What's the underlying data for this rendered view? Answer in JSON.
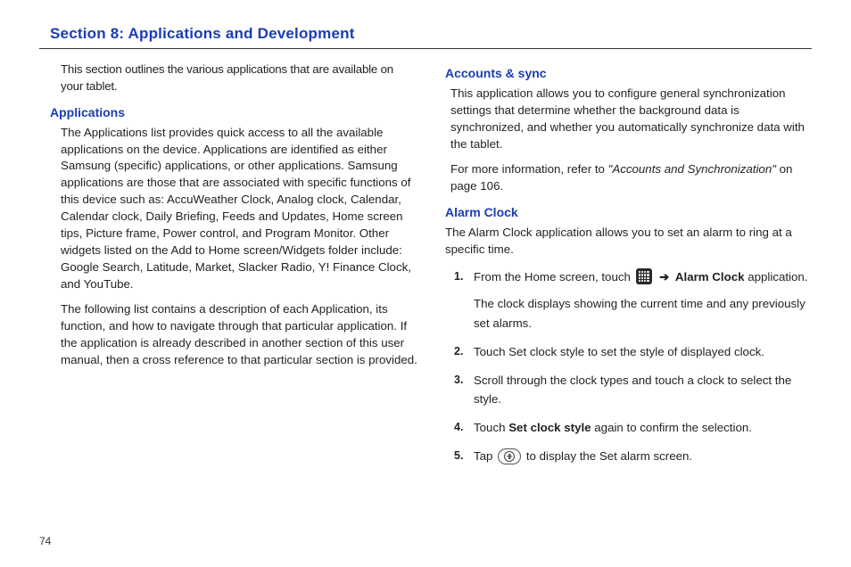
{
  "page": {
    "title": "Section 8: Applications and Development",
    "number": "74"
  },
  "left": {
    "intro": "This section outlines the various applications that are available on your tablet.",
    "applications": {
      "heading": "Applications",
      "p1": "The Applications list provides quick access to all the available applications on the device. Applications are identified as either Samsung (specific) applications, or other applications. Samsung applications are those that are associated with specific functions of this device such as: AccuWeather Clock, Analog clock, Calendar, Calendar clock, Daily Briefing, Feeds and Updates, Home screen tips, Picture frame, Power control, and Program Monitor. Other widgets listed on the Add to Home screen/Widgets folder include: Google Search, Latitude, Market, Slacker Radio, Y! Finance Clock, and YouTube.",
      "p2": "The following list contains a description of each Application, its function, and how to navigate through that particular application. If the application is already described in another section of this user manual, then a cross reference to that particular section is provided."
    }
  },
  "right": {
    "accounts": {
      "heading": "Accounts & sync",
      "p1": "This application allows you to configure general synchronization settings that determine whether the background data is synchronized, and whether you automatically synchronize data with the tablet.",
      "p2a": "For more information, refer to ",
      "p2b": "\"Accounts and Synchronization\"",
      "p2c": " on page 106."
    },
    "alarm": {
      "heading": "Alarm Clock",
      "intro": "The Alarm Clock application allows you to set an alarm to ring at a specific time.",
      "steps": {
        "s1a": "From the Home screen, touch ",
        "s1arrow": "➔",
        "s1bold": "Alarm Clock",
        "s1b": " application.",
        "s1note": "The clock displays showing the current time and any previously set alarms.",
        "s2": "Touch Set clock style to set the style of displayed clock.",
        "s3": "Scroll through the clock types and touch a clock to select the style.",
        "s4a": "Touch ",
        "s4bold": "Set clock style",
        "s4b": " again to confirm the selection.",
        "s5a": "Tap ",
        "s5b": " to display the Set alarm screen."
      },
      "nums": {
        "n1": "1.",
        "n2": "2.",
        "n3": "3.",
        "n4": "4.",
        "n5": "5."
      }
    }
  }
}
